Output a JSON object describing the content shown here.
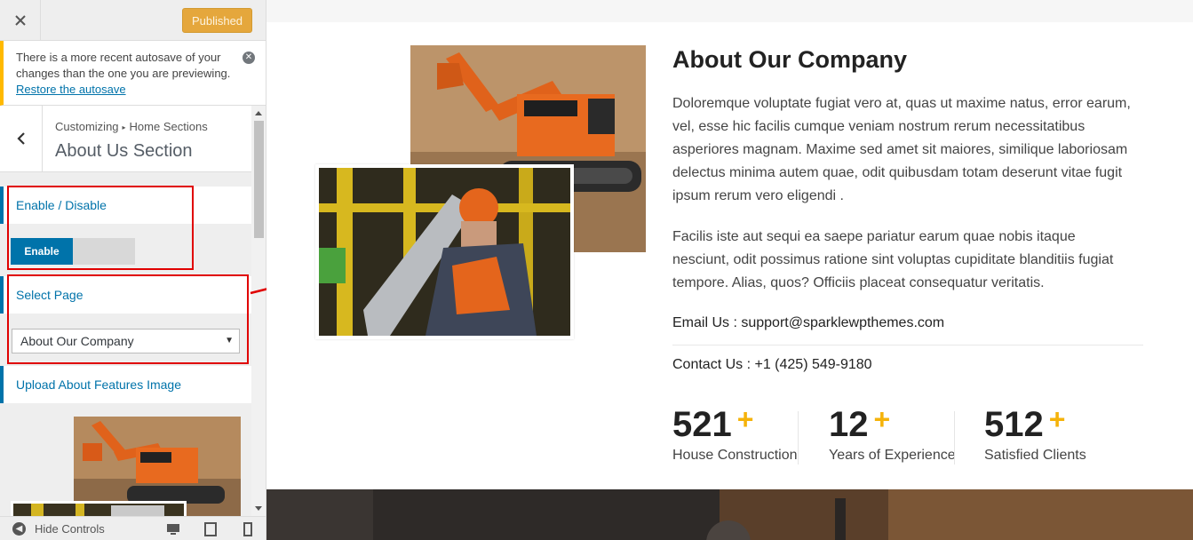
{
  "topbar": {
    "close_label": "✕",
    "published_label": "Published"
  },
  "notice": {
    "text": "There is a more recent autosave of your changes than the one you are previewing.",
    "link": "Restore the autosave"
  },
  "section": {
    "breadcrumb_root": "Customizing",
    "breadcrumb_sep": "▸",
    "breadcrumb_parent": "Home Sections",
    "title": "About Us Section"
  },
  "controls": {
    "enable_title": "Enable / Disable",
    "toggle_label": "Enable",
    "toggle_value": "on",
    "page_title": "Select Page",
    "page_selected": "About Our Company",
    "image_title": "Upload About Features Image"
  },
  "footer": {
    "hide_controls": "Hide Controls"
  },
  "preview": {
    "heading": "About Our Company",
    "paragraph1": "Doloremque voluptate fugiat vero at, quas ut maxime natus, error earum, vel, esse hic facilis cumque veniam nostrum rerum necessitatibus asperiores magnam. Maxime sed amet sit maiores, similique laboriosam delectus minima autem quae, odit quibusdam totam deserunt vitae fugit ipsum rerum vero eligendi .",
    "paragraph2": "Facilis iste aut sequi ea saepe pariatur earum quae nobis itaque nesciunt, odit possimus ratione sint voluptas cupiditate blanditiis fugiat tempore. Alias, quos? Officiis placeat consequatur veritatis.",
    "email": "Email Us : support@sparklewpthemes.com",
    "phone": "Contact Us : +1 (425) 549-9180",
    "stats": [
      {
        "number": "521",
        "plus": "+",
        "label": "House Construction"
      },
      {
        "number": "12",
        "plus": "+",
        "label": "Years of Experience"
      },
      {
        "number": "512",
        "plus": "+",
        "label": "Satisfied Clients"
      }
    ]
  },
  "colors": {
    "accent": "#0073aa",
    "published": "#e5a73c",
    "highlight": "#e00000",
    "stat_plus": "#f5b30a",
    "notice_border": "#ffb900"
  }
}
